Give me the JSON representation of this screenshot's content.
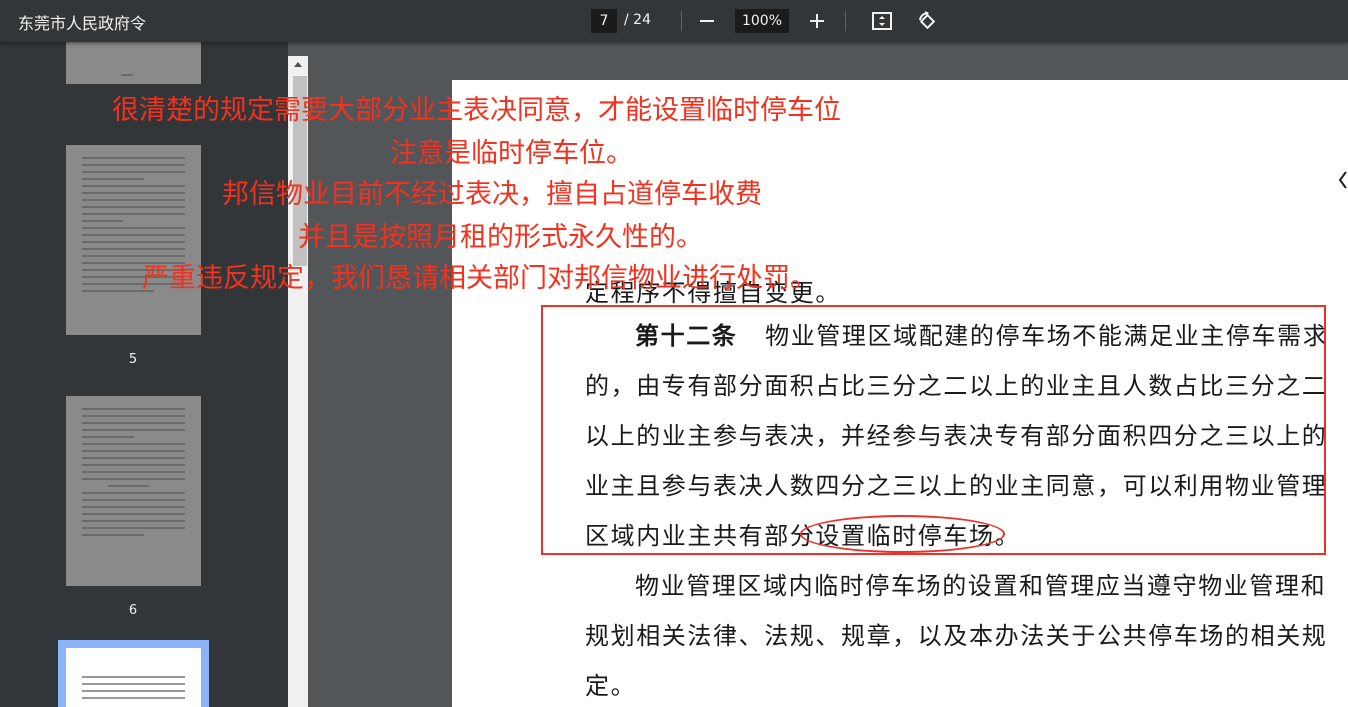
{
  "toolbar": {
    "title": "东莞市人民政府令",
    "current_page": "7",
    "total_pages": "/ 24",
    "zoom": "100%"
  },
  "sidebar": {
    "thumbnails": [
      {
        "number": "5"
      },
      {
        "number": "6"
      }
    ]
  },
  "document": {
    "prev_line": "定程序不得擅自变更。",
    "article_12": {
      "heading": "第十二条",
      "lines": [
        "物业管理区域配建的停车场不能满足业主停车需求",
        "的，由专有部分面积占比三分之二以上的业主且人数占比三分之二",
        "以上的业主参与表决，并经参与表决专有部分面积四分之三以上的",
        "业主且参与表决人数四分之三以上的业主同意，可以利用物业管理",
        "区域内业主共有部分设置临时停车场。"
      ]
    },
    "next_para": [
      "物业管理区域内临时停车场的设置和管理应当遵守物业管理和",
      "规划相关法律、法规、规章，以及本办法关于公共停车场的相关规",
      "定。"
    ]
  },
  "annotations": {
    "line1": "很清楚的规定需要大部分业主表决同意，才能设置临时停车位",
    "line2": "注意是临时停车位。",
    "line3": "邦信物业目前不经过表决，擅自占道停车收费",
    "line4": "并且是按照月租的形式永久性的。",
    "line5": "严重违反规定，我们恳请相关部门对邦信物业进行处罚。",
    "color": "#f2321e"
  }
}
